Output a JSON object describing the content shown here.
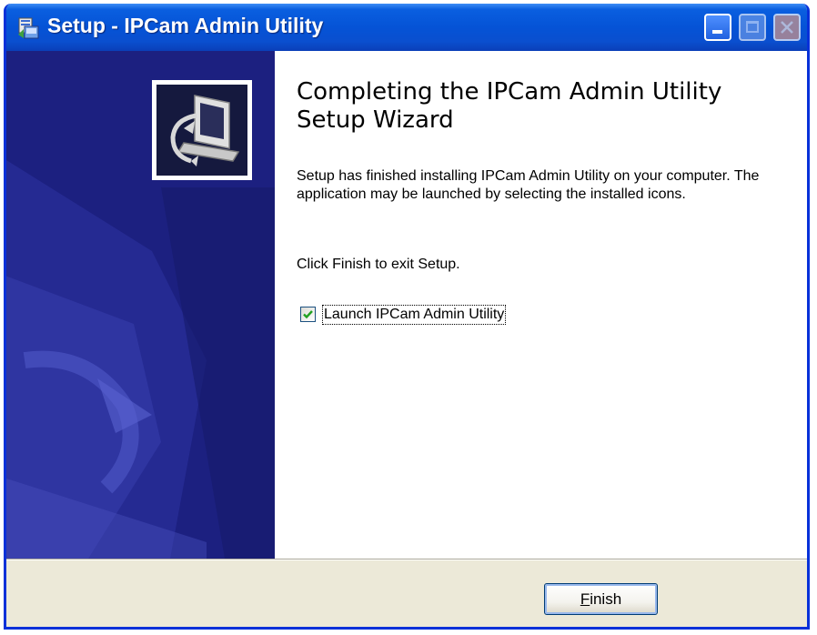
{
  "window": {
    "title": "Setup - IPCam Admin Utility",
    "title_icon": "setup-installer-icon"
  },
  "titlebar_buttons": {
    "minimize_icon": "minimize-icon",
    "maximize_icon": "maximize-icon",
    "close_icon": "close-icon"
  },
  "banner": {
    "logo_icon": "computer-install-icon",
    "color": "#1a1e7a"
  },
  "content": {
    "heading": "Completing the IPCam Admin Utility Setup Wizard",
    "paragraph1": "Setup has finished installing IPCam Admin Utility on your computer. The application may be launched by selecting the installed icons.",
    "paragraph2": "Click Finish to exit Setup.",
    "launch_checkbox": {
      "label": "Launch IPCam Admin Utility",
      "checked": true
    }
  },
  "footer": {
    "finish_label_first": "F",
    "finish_label_rest": "inish"
  },
  "colors": {
    "titlebar": "#0553d6",
    "face": "#ece9d8",
    "check": "#21a121"
  }
}
